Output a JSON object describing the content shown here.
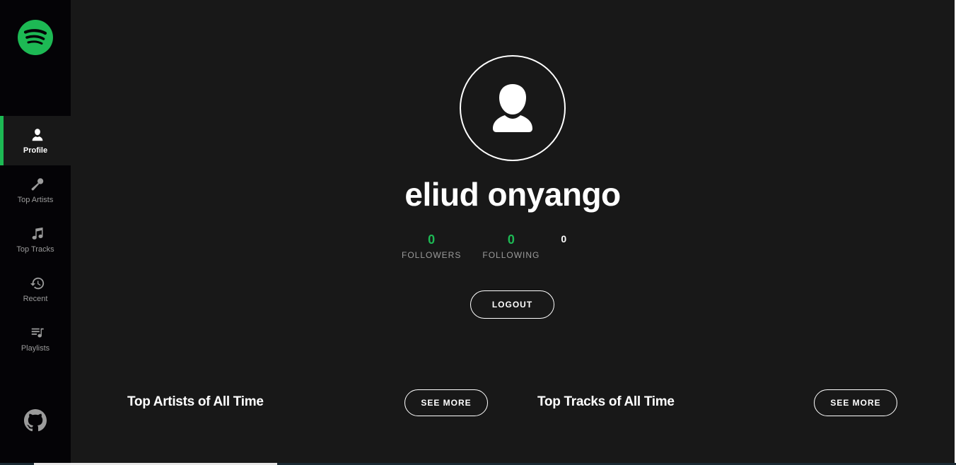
{
  "sidebar": {
    "logo_icon": "spotify-logo-icon",
    "items": [
      {
        "label": "Profile",
        "icon": "user-icon",
        "active": true
      },
      {
        "label": "Top Artists",
        "icon": "microphone-icon",
        "active": false
      },
      {
        "label": "Top Tracks",
        "icon": "music-note-icon",
        "active": false
      },
      {
        "label": "Recent",
        "icon": "history-icon",
        "active": false
      },
      {
        "label": "Playlists",
        "icon": "playlist-icon",
        "active": false
      }
    ],
    "github_icon": "github-icon"
  },
  "profile": {
    "avatar_icon": "user-icon",
    "name": "eliud onyango",
    "followers_count": "0",
    "followers_label": "FOLLOWERS",
    "following_count": "0",
    "following_label": "FOLLOWING",
    "playlists_count": "0",
    "logout_label": "LOGOUT"
  },
  "sections": {
    "artists_title": "Top Artists of All Time",
    "artists_button": "SEE MORE",
    "tracks_title": "Top Tracks of All Time",
    "tracks_button": "SEE MORE"
  },
  "colors": {
    "accent": "#1db954",
    "sidebar_bg": "#040306",
    "main_bg": "#181818",
    "muted_text": "#9b9b9b"
  }
}
